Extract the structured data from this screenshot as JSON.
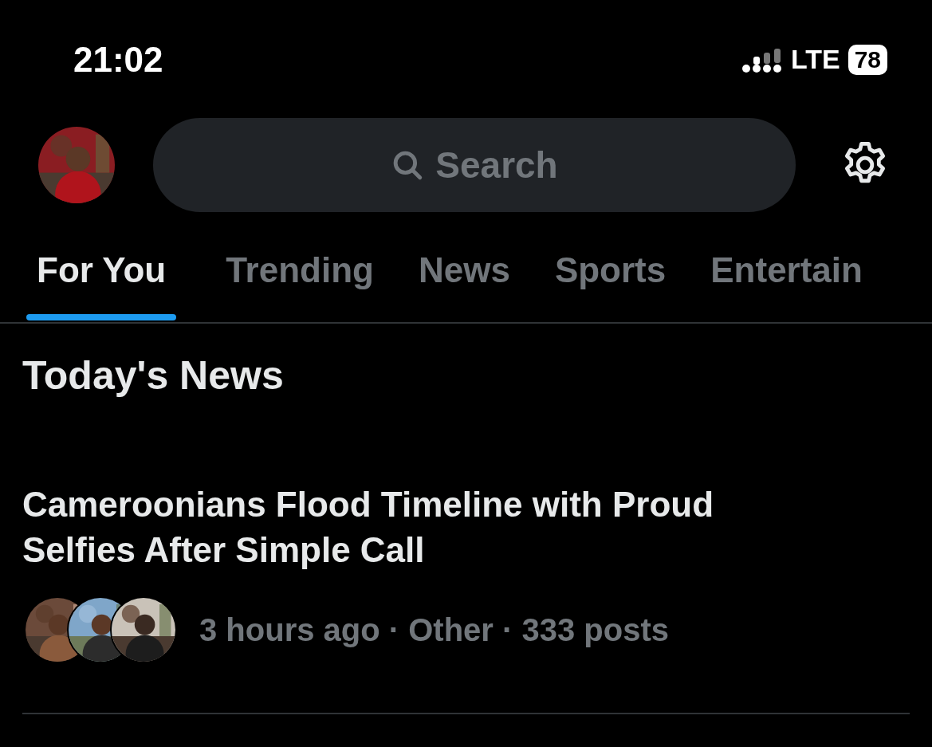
{
  "status_bar": {
    "time": "21:02",
    "network": "LTE",
    "battery": "78"
  },
  "header": {
    "search": {
      "placeholder": "Search"
    }
  },
  "tabs": [
    {
      "label": "For You",
      "selected": true
    },
    {
      "label": "Trending",
      "selected": false
    },
    {
      "label": "News",
      "selected": false
    },
    {
      "label": "Sports",
      "selected": false
    },
    {
      "label": "Entertain",
      "selected": false
    }
  ],
  "section_title": "Today's News",
  "stories": [
    {
      "title": "Cameroonians Flood Timeline with Proud Selfies After Simple Call",
      "meta": "3 hours ago · Other · 333 posts"
    }
  ]
}
